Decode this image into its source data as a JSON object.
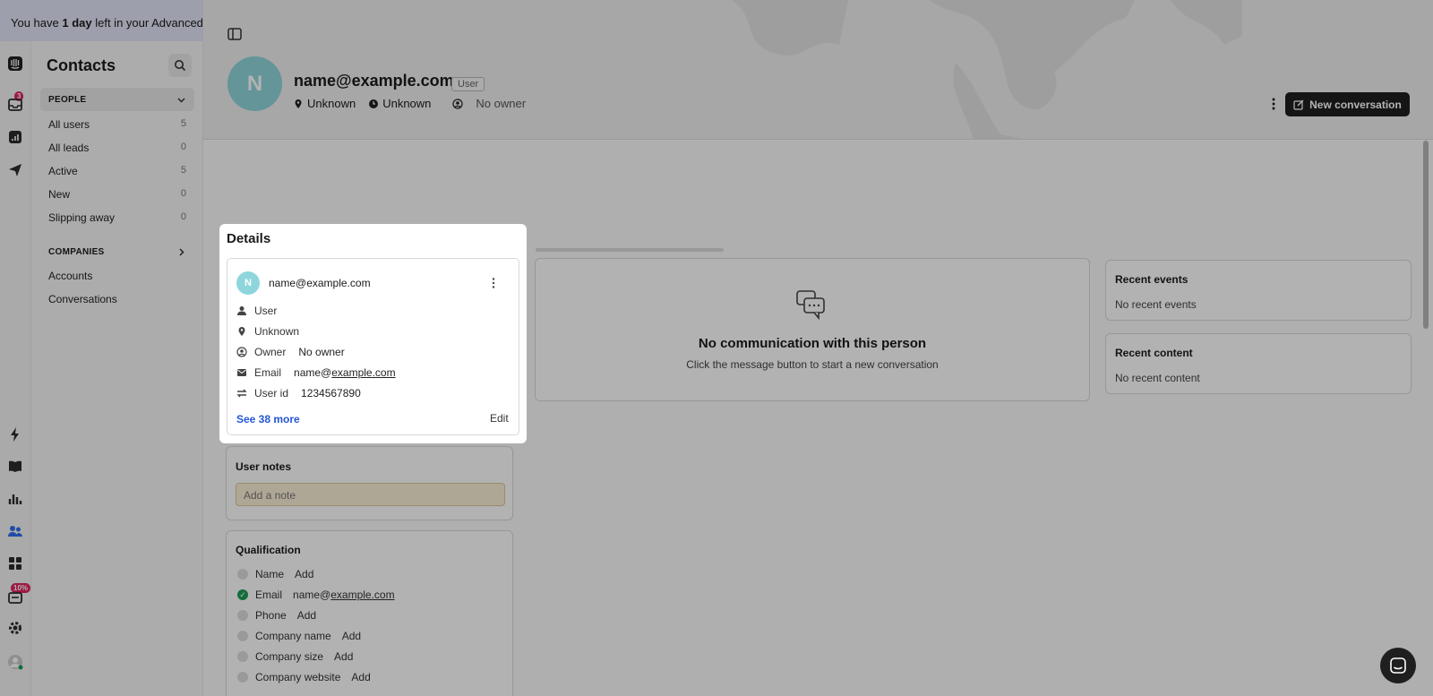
{
  "trial": {
    "prefix": "You have ",
    "bold": "1 day",
    "suffix": " left in your Advanced trial"
  },
  "rail": {
    "inbox_badge": "3",
    "learn_badge": "10%"
  },
  "sidebar": {
    "title": "Contacts",
    "people_section": "PEOPLE",
    "people_items": [
      {
        "label": "All users",
        "count": "5"
      },
      {
        "label": "All leads",
        "count": "0"
      },
      {
        "label": "Active",
        "count": "5"
      },
      {
        "label": "New",
        "count": "0"
      },
      {
        "label": "Slipping away",
        "count": "0"
      }
    ],
    "companies_section": "COMPANIES",
    "company_items": [
      {
        "label": "Accounts"
      },
      {
        "label": "Conversations"
      }
    ]
  },
  "header": {
    "avatar_letter": "N",
    "name": "name@example.com",
    "tag": "User",
    "location": "Unknown",
    "time": "Unknown",
    "owner": "No owner",
    "new_conversation": "New conversation"
  },
  "details": {
    "title": "Details",
    "avatar_letter": "N",
    "email_heading": "name@example.com",
    "role": "User",
    "location": "Unknown",
    "owner_label": "Owner",
    "owner_value": "No owner",
    "email_label": "Email",
    "email_local": "name@",
    "email_domain": "example.com",
    "userid_label": "User id",
    "userid_value": "1234567890",
    "see_more": "See 38 more",
    "edit": "Edit"
  },
  "notes": {
    "title": "User notes",
    "placeholder": "Add a note"
  },
  "qualification": {
    "title": "Qualification",
    "rows": [
      {
        "label": "Name",
        "value": "Add"
      },
      {
        "label": "Email",
        "value_prefix": "name@",
        "value_link": "example.com"
      },
      {
        "label": "Phone",
        "value": "Add"
      },
      {
        "label": "Company name",
        "value": "Add"
      },
      {
        "label": "Company size",
        "value": "Add"
      },
      {
        "label": "Company website",
        "value": "Add"
      }
    ]
  },
  "communication": {
    "title": "No communication with this person",
    "subtitle": "Click the message button to start a new conversation"
  },
  "recent_events": {
    "title": "Recent events",
    "empty": "No recent events"
  },
  "recent_content": {
    "title": "Recent content",
    "empty": "No recent content"
  },
  "colors": {
    "accent": "#2356d6",
    "avatar": "#8ed6dc",
    "success": "#1e9e55",
    "dark_button": "#1f1f1f"
  }
}
